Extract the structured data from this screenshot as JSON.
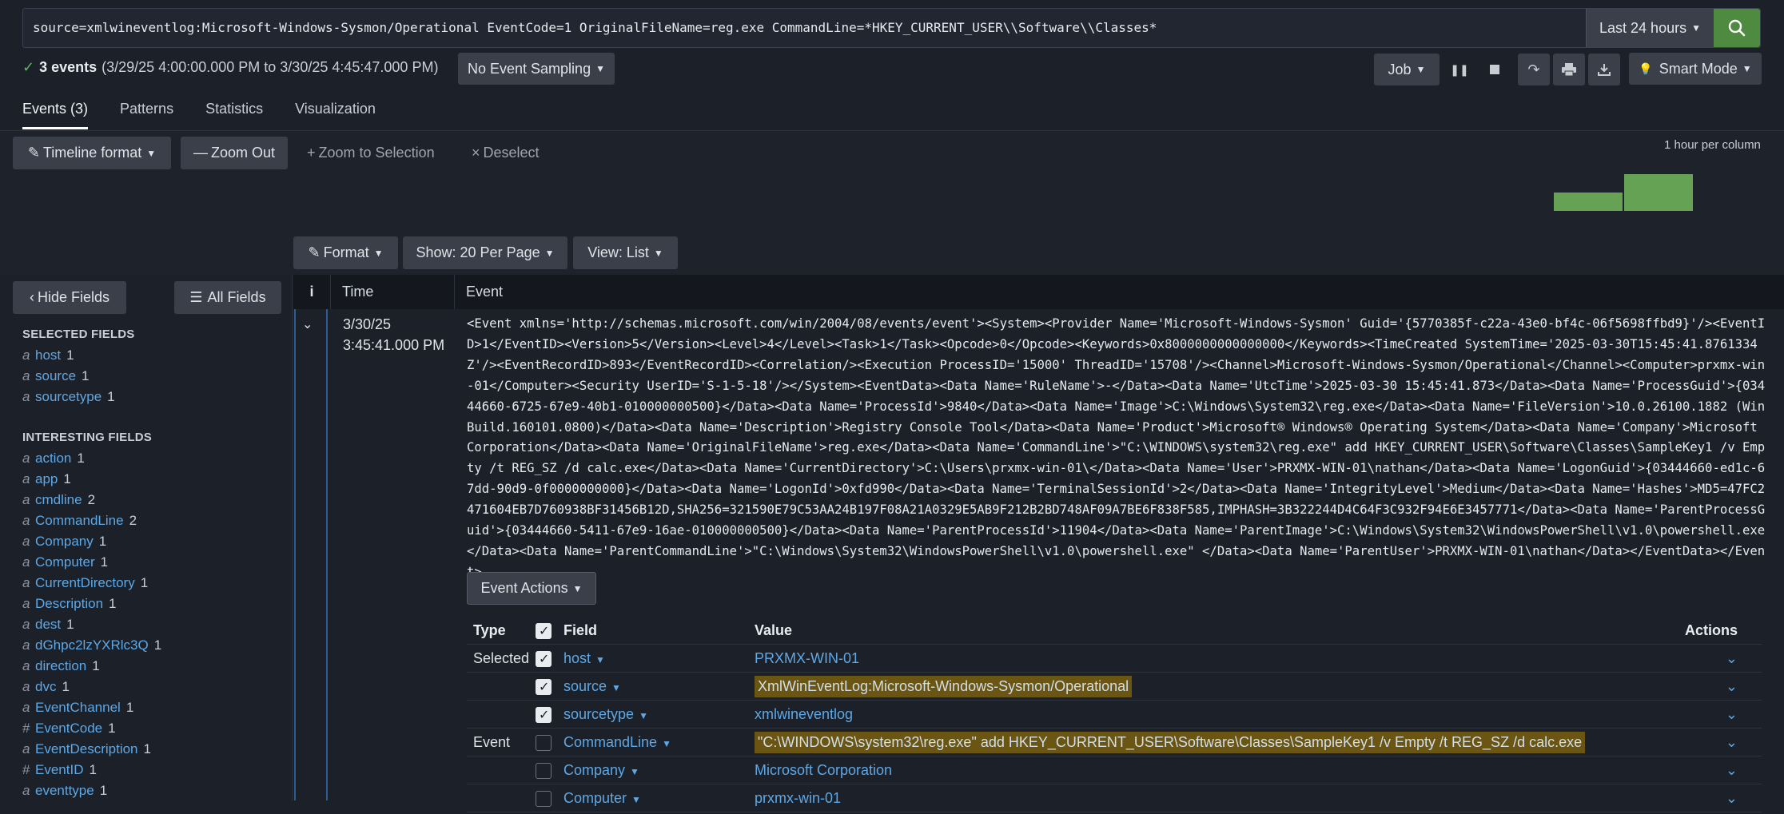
{
  "search": {
    "query": "source=xmlwineventlog:Microsoft-Windows-Sysmon/Operational EventCode=1 OriginalFileName=reg.exe CommandLine=*HKEY_CURRENT_USER\\\\Software\\\\Classes*",
    "time_range": "Last 24 hours"
  },
  "summary": {
    "count_label": "3 events",
    "range": "(3/29/25 4:00:00.000 PM to 3/30/25 4:45:47.000 PM)",
    "sampling": "No Event Sampling",
    "job": "Job",
    "mode": "Smart Mode"
  },
  "tabs": [
    "Events (3)",
    "Patterns",
    "Statistics",
    "Visualization"
  ],
  "timeline": {
    "format": "Timeline format",
    "zoom_out": "Zoom Out",
    "zoom_selection": "Zoom to Selection",
    "deselect": "Deselect",
    "per_column": "1 hour per column",
    "bars": [
      1,
      2
    ]
  },
  "results_toolbar": {
    "format": "Format",
    "per_page": "Show: 20 Per Page",
    "view": "View: List"
  },
  "sidebar": {
    "hide_fields": "Hide Fields",
    "all_fields": "All Fields",
    "selected_title": "SELECTED FIELDS",
    "selected": [
      {
        "type": "a",
        "name": "host",
        "count": "1"
      },
      {
        "type": "a",
        "name": "source",
        "count": "1"
      },
      {
        "type": "a",
        "name": "sourcetype",
        "count": "1"
      }
    ],
    "interesting_title": "INTERESTING FIELDS",
    "interesting": [
      {
        "type": "a",
        "name": "action",
        "count": "1"
      },
      {
        "type": "a",
        "name": "app",
        "count": "1"
      },
      {
        "type": "a",
        "name": "cmdline",
        "count": "2"
      },
      {
        "type": "a",
        "name": "CommandLine",
        "count": "2"
      },
      {
        "type": "a",
        "name": "Company",
        "count": "1"
      },
      {
        "type": "a",
        "name": "Computer",
        "count": "1"
      },
      {
        "type": "a",
        "name": "CurrentDirectory",
        "count": "1"
      },
      {
        "type": "a",
        "name": "Description",
        "count": "1"
      },
      {
        "type": "a",
        "name": "dest",
        "count": "1"
      },
      {
        "type": "a",
        "name": "dGhpc2lzYXRlc3Q",
        "count": "1"
      },
      {
        "type": "a",
        "name": "direction",
        "count": "1"
      },
      {
        "type": "a",
        "name": "dvc",
        "count": "1"
      },
      {
        "type": "a",
        "name": "EventChannel",
        "count": "1"
      },
      {
        "type": "#",
        "name": "EventCode",
        "count": "1"
      },
      {
        "type": "a",
        "name": "EventDescription",
        "count": "1"
      },
      {
        "type": "#",
        "name": "EventID",
        "count": "1"
      },
      {
        "type": "a",
        "name": "eventtype",
        "count": "1"
      }
    ]
  },
  "events_table": {
    "col_i": "i",
    "col_time": "Time",
    "col_event": "Event"
  },
  "event": {
    "date": "3/30/25",
    "time": "3:45:41.000 PM",
    "raw": "<Event xmlns='http://schemas.microsoft.com/win/2004/08/events/event'><System><Provider Name='Microsoft-Windows-Sysmon' Guid='{5770385f-c22a-43e0-bf4c-06f5698ffbd9}'/><EventID>1</EventID><Version>5</Version><Level>4</Level><Task>1</Task><Opcode>0</Opcode><Keywords>0x8000000000000000</Keywords><TimeCreated SystemTime='2025-03-30T15:45:41.8761334Z'/><EventRecordID>893</EventRecordID><Correlation/><Execution ProcessID='15000' ThreadID='15708'/><Channel>Microsoft-Windows-Sysmon/Operational</Channel><Computer>prxmx-win-01</Computer><Security UserID='S-1-5-18'/></System><EventData><Data Name='RuleName'>-</Data><Data Name='UtcTime'>2025-03-30 15:45:41.873</Data><Data Name='ProcessGuid'>{03444660-6725-67e9-40b1-010000000500}</Data><Data Name='ProcessId'>9840</Data><Data Name='Image'>C:\\Windows\\System32\\reg.exe</Data><Data Name='FileVersion'>10.0.26100.1882 (WinBuild.160101.0800)</Data><Data Name='Description'>Registry Console Tool</Data><Data Name='Product'>Microsoft® Windows® Operating System</Data><Data Name='Company'>Microsoft Corporation</Data><Data Name='OriginalFileName'>reg.exe</Data><Data Name='CommandLine'>\"C:\\WINDOWS\\system32\\reg.exe\" add HKEY_CURRENT_USER\\Software\\Classes\\SampleKey1 /v Empty /t REG_SZ /d calc.exe</Data><Data Name='CurrentDirectory'>C:\\Users\\prxmx-win-01\\</Data><Data Name='User'>PRXMX-WIN-01\\nathan</Data><Data Name='LogonGuid'>{03444660-ed1c-67dd-90d9-0f0000000000}</Data><Data Name='LogonId'>0xfd990</Data><Data Name='TerminalSessionId'>2</Data><Data Name='IntegrityLevel'>Medium</Data><Data Name='Hashes'>MD5=47FC2471604EB7D760938BF31456B12D,SHA256=321590E79C53AA24B197F08A21A0329E5AB9F212B2BD748AF09A7BE6F838F585,IMPHASH=3B322244D4C64F3C932F94E6E3457771</Data><Data Name='ParentProcessGuid'>{03444660-5411-67e9-16ae-010000000500}</Data><Data Name='ParentProcessId'>11904</Data><Data Name='ParentImage'>C:\\Windows\\System32\\WindowsPowerShell\\v1.0\\powershell.exe</Data><Data Name='ParentCommandLine'>\"C:\\Windows\\System32\\WindowsPowerShell\\v1.0\\powershell.exe\" </Data><Data Name='ParentUser'>PRXMX-WIN-01\\nathan</Data></EventData></Event>",
    "actions_label": "Event Actions"
  },
  "field_table": {
    "head": {
      "type": "Type",
      "field": "Field",
      "value": "Value",
      "actions": "Actions"
    },
    "rows": [
      {
        "type": "Selected",
        "checked": true,
        "field": "host",
        "value": "PRXMX-WIN-01",
        "highlight": false
      },
      {
        "type": "",
        "checked": true,
        "field": "source",
        "value": "XmlWinEventLog:Microsoft-Windows-Sysmon/Operational",
        "highlight": true
      },
      {
        "type": "",
        "checked": true,
        "field": "sourcetype",
        "value": "xmlwineventlog",
        "highlight": false
      },
      {
        "type": "Event",
        "checked": false,
        "field": "CommandLine",
        "value": "\"C:\\WINDOWS\\system32\\reg.exe\" add HKEY_CURRENT_USER\\Software\\Classes\\SampleKey1 /v Empty /t REG_SZ /d calc.exe",
        "highlight": true
      },
      {
        "type": "",
        "checked": false,
        "field": "Company",
        "value": "Microsoft Corporation",
        "highlight": false
      },
      {
        "type": "",
        "checked": false,
        "field": "Computer",
        "value": "prxmx-win-01",
        "highlight": false
      }
    ]
  },
  "colors": {
    "accent_link": "#5ea8e6",
    "search_button": "#4e8a3f",
    "timeline_bar": "#65a253",
    "highlight": "#6b5512"
  }
}
